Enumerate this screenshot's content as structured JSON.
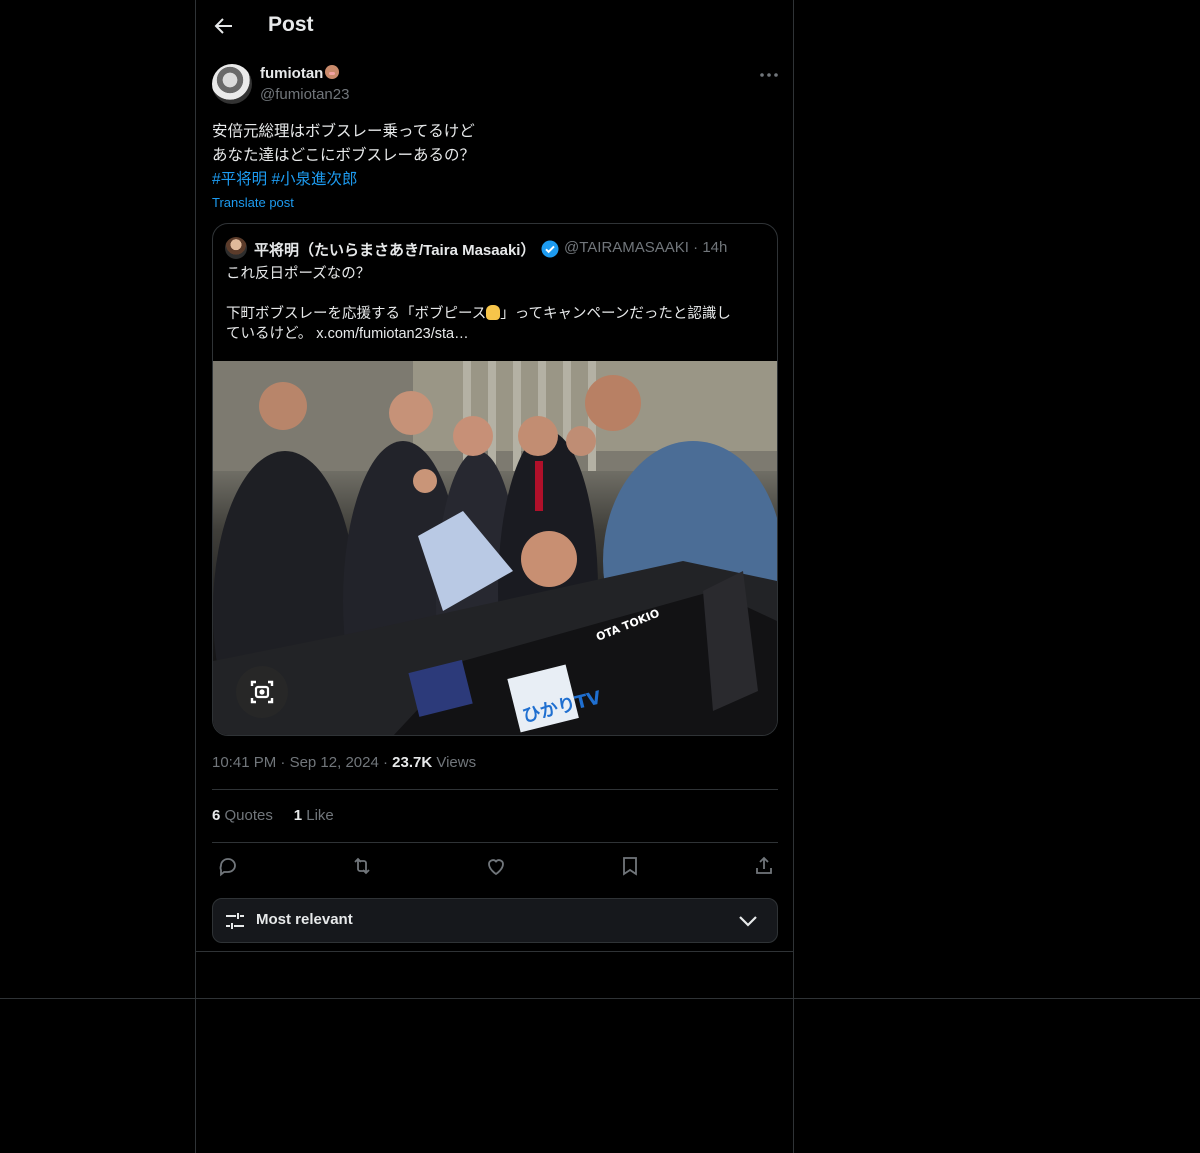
{
  "header": {
    "title": "Post",
    "back_icon": "arrow-left-icon"
  },
  "post": {
    "author_name": "fumiotan",
    "author_emoji": "dog-face-emoji",
    "author_handle": "@fumiotan23",
    "more_icon": "ellipsis-icon",
    "text_lines": [
      "安倍元総理はボブスレー乗ってるけど",
      "あなた達はどこにボブスレーあるの？"
    ],
    "hashtags": [
      "#平将明",
      "#小泉進次郎"
    ],
    "translate_label": "Translate post",
    "quote": {
      "author_name": "平将明（たいらまさあき/Taira Masaaki）",
      "verified_icon": "verified-badge-icon",
      "author_handle": "@TAIRAMASAAKI",
      "separator": "·",
      "time_ago": "14h",
      "line1": "これ反日ポーズなの？",
      "line2_a": "下町ボブスレーを応援する「ボブピース",
      "line2_b": "」ってキャンペーンだったと認識し",
      "line3": "ているけど。 x.com/fumiotan23/sta…",
      "photo_label": "Group photo with bobsleigh",
      "lens_icon": "image-search-icon"
    },
    "time": "10:41 PM",
    "date": "Sep 12, 2024",
    "views_count": "23.7K",
    "views_label": "Views",
    "dot": "·",
    "quotes_count": "6",
    "quotes_label": "Quotes",
    "likes_count": "1",
    "likes_label": "Like"
  },
  "actions": [
    "reply-icon",
    "repost-icon",
    "like-icon",
    "bookmark-icon",
    "share-icon"
  ],
  "sort": {
    "label": "Most relevant",
    "icon": "sliders-icon",
    "chevron": "chevron-down-icon"
  },
  "colors": {
    "accent": "#1d9bf0",
    "text": "#e7e9ea",
    "muted": "#71767b",
    "border": "#2f3336",
    "background": "#000000"
  }
}
